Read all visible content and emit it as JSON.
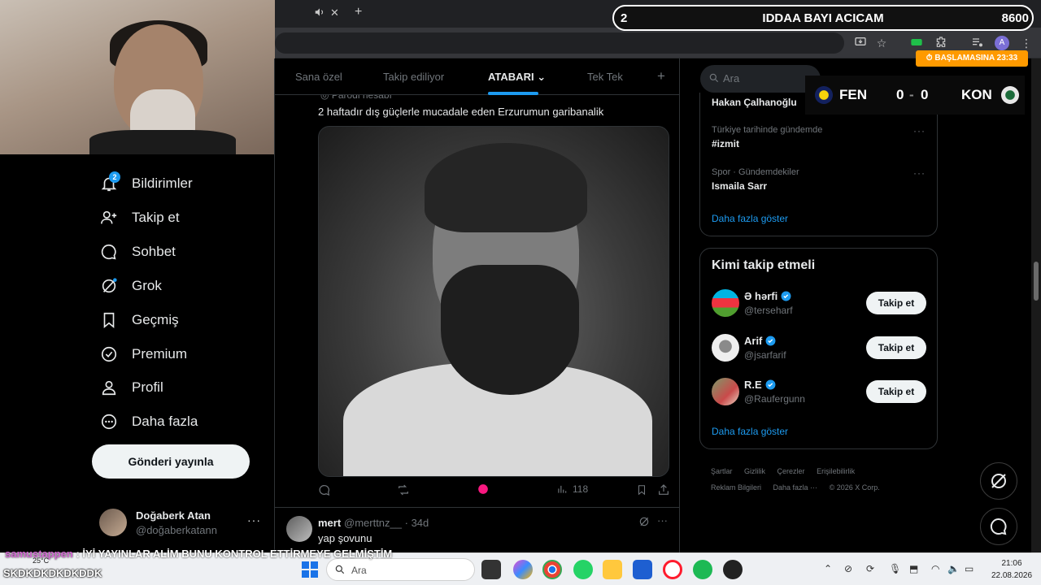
{
  "browser": {
    "tab_close": "✕",
    "tab_new": "+",
    "avatar_letter": "A",
    "window_min": "—",
    "window_max": "▢",
    "window_close": "✕"
  },
  "overlay": {
    "left_number": "2",
    "title": "IDDAA BAYI ACICAM",
    "right_number": "8600",
    "timer_label": "⏱ BAŞLAMASINA 23:33",
    "score": {
      "home": "FEN",
      "home_score": "0",
      "sep": "-",
      "away_score": "0",
      "away": "KON"
    }
  },
  "nav": {
    "items": [
      {
        "label": "Bildirimler",
        "icon": "bell-icon"
      },
      {
        "label": "Takip et",
        "icon": "add-user-icon"
      },
      {
        "label": "Sohbet",
        "icon": "chat-icon"
      },
      {
        "label": "Grok",
        "icon": "grok-icon"
      },
      {
        "label": "Geçmiş",
        "icon": "bookmark-icon"
      },
      {
        "label": "Premium",
        "icon": "verified-icon"
      },
      {
        "label": "Profil",
        "icon": "person-icon"
      },
      {
        "label": "Daha fazla",
        "icon": "more-circle-icon"
      }
    ],
    "notification_count": "2",
    "post_button": "Gönderi yayınla",
    "account": {
      "name": "Doğaberk Atan",
      "handle": "@doğaberkatann",
      "more": "···"
    }
  },
  "main": {
    "tabs": [
      {
        "label": "Sana özel",
        "active": false
      },
      {
        "label": "Takip ediliyor",
        "active": false
      },
      {
        "label": "ATABARI",
        "active": true
      },
      {
        "label": "Tek Tek",
        "active": false
      }
    ],
    "tab_add": "+",
    "tweet": {
      "parody_label": "Parodi hesabı",
      "text": "2 haftadır dış güçlerle mucadale eden Erzurumun garibanalik",
      "views": "118"
    },
    "reply": {
      "name": "mert",
      "handle": "@merttnz__",
      "time": "· 34d",
      "text": "yap şovunu"
    }
  },
  "right": {
    "search_placeholder": "Ara",
    "trends": [
      {
        "context": "",
        "title": "Hakan Çalhanoğlu"
      },
      {
        "context": "Türkiye tarihinde gündemde",
        "title": "#izmit"
      },
      {
        "context": "Spor · Gündemdekiler",
        "title": "Ismaila Sarr"
      }
    ],
    "trends_more": "Daha fazla göster",
    "who_to_follow": {
      "title": "Kimi takip etmeli",
      "users": [
        {
          "name": "Ə hərfi",
          "handle": "@terseharf",
          "button": "Takip et"
        },
        {
          "name": "Arif",
          "handle": "@jsarfarif",
          "button": "Takip et"
        },
        {
          "name": "R.E",
          "handle": "@Raufergunn",
          "button": "Takip et"
        }
      ],
      "more": "Daha fazla göster"
    },
    "footer": [
      "Şartlar",
      "Gizlilik",
      "Çerezler",
      "Erişilebilirlik",
      "Reklam Bilgileri",
      "Daha fazla ···",
      "© 2026 X Corp."
    ]
  },
  "chat": {
    "user": "samustappen",
    "message": ": İYİ YAYINLAR ALİM BUNU KONTROL ETTİRMEYE GELMİŞTİM"
  },
  "taskbar": {
    "weather": "25°C",
    "overlay_text": "SKDKDKDKDKDDK",
    "search_placeholder": "Ara",
    "time": "21:06",
    "date": "22.08.2026"
  },
  "colors": {
    "accent": "#1d9bf0",
    "like_pink": "#f91880",
    "timer_orange": "#ff9a00"
  }
}
